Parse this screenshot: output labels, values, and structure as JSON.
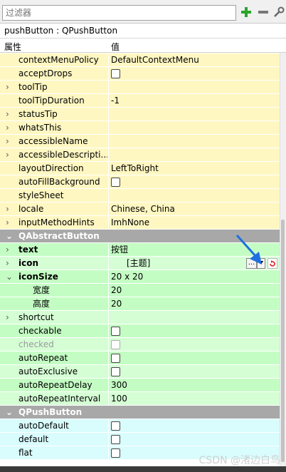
{
  "filter": {
    "placeholder": "过滤器"
  },
  "toolbar": {
    "add_icon": "plus-icon",
    "remove_icon": "minus-icon",
    "config_icon": "wrench-icon"
  },
  "object": {
    "label": "pushButton : QPushButton"
  },
  "header": {
    "property": "属性",
    "value": "值"
  },
  "rows": [
    {
      "name": "contextMenuPolicy",
      "value": "DefaultContextMenu"
    },
    {
      "name": "acceptDrops"
    },
    {
      "name": "toolTip"
    },
    {
      "name": "toolTipDuration",
      "value": "-1"
    },
    {
      "name": "statusTip"
    },
    {
      "name": "whatsThis"
    },
    {
      "name": "accessibleName"
    },
    {
      "name": "accessibleDescripti..."
    },
    {
      "name": "layoutDirection",
      "value": "LeftToRight"
    },
    {
      "name": "autoFillBackground"
    },
    {
      "name": "styleSheet"
    },
    {
      "name": "locale",
      "value": "Chinese, China"
    },
    {
      "name": "inputMethodHints",
      "value": "ImhNone"
    },
    {
      "name": "QAbstractButton"
    },
    {
      "name": "text",
      "value": "按钮"
    },
    {
      "name": "icon",
      "value": "[主题]",
      "dots": "..."
    },
    {
      "name": "iconSize",
      "value": "20 x 20"
    },
    {
      "name": "宽度",
      "value": "20"
    },
    {
      "name": "高度",
      "value": "20"
    },
    {
      "name": "shortcut"
    },
    {
      "name": "checkable"
    },
    {
      "name": "checked"
    },
    {
      "name": "autoRepeat"
    },
    {
      "name": "autoExclusive"
    },
    {
      "name": "autoRepeatDelay",
      "value": "300"
    },
    {
      "name": "autoRepeatInterval",
      "value": "100"
    },
    {
      "name": "QPushButton"
    },
    {
      "name": "autoDefault"
    },
    {
      "name": "default"
    },
    {
      "name": "flat"
    }
  ],
  "watermark": "CSDN @渚边白鸟",
  "colors": {
    "yellow_row": "#fff7c2",
    "green_row": "#c4fdc4",
    "light_green_row": "#d5fed5",
    "cyan_row": "#d9fcfd",
    "section_header": "#a8a8a8",
    "annotation_arrow": "#1f6fe0"
  }
}
